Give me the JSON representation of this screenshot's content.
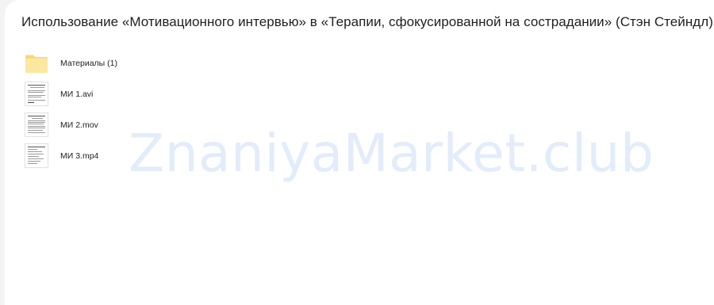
{
  "page": {
    "title": "Использование «Мотивационного интервью» в «Терапии, сфокусированной на сострадании» (Стэн Стейндл)"
  },
  "files": [
    {
      "name": "Материалы (1)",
      "type": "folder",
      "icon": "folder-icon"
    },
    {
      "name": "МИ 1.avi",
      "type": "file",
      "icon": "document-thumbnail-icon"
    },
    {
      "name": "МИ 2.mov",
      "type": "file",
      "icon": "document-thumbnail-icon"
    },
    {
      "name": "МИ 3.mp4",
      "type": "file",
      "icon": "document-thumbnail-icon"
    }
  ],
  "watermark": "ZnaniyaMarket.club",
  "colors": {
    "background": "#f3f3f3",
    "panel": "#ffffff",
    "folder": "#fde28a",
    "watermark": "#dde9fa"
  }
}
